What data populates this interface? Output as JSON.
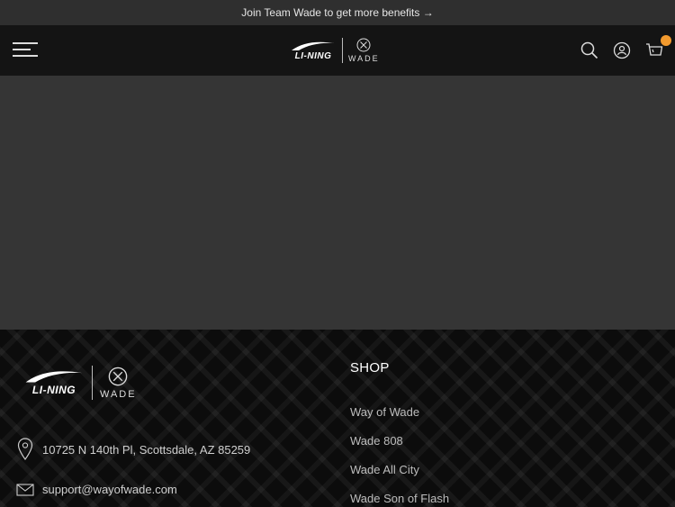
{
  "announcement": {
    "text": "Join Team Wade to get more benefits →"
  },
  "header": {
    "brand_name": "LI-NING",
    "sub_brand": "WADE",
    "cart_count": ""
  },
  "footer": {
    "brand_name": "LI-NING",
    "sub_brand": "WADE",
    "address": "10725 N 140th Pl, Scottsdale, AZ 85259",
    "email": "support@wayofwade.com",
    "shop": {
      "title": "SHOP",
      "links": [
        "Way of Wade",
        "Wade 808",
        "Wade All City",
        "Wade Son of Flash"
      ]
    }
  },
  "colors": {
    "announcement_bg": "#2f2f2f",
    "header_bg": "#141414",
    "hero_bg": "#353535",
    "footer_bg": "#0c0c0c",
    "cart_badge": "#f29a2e"
  },
  "icons": [
    "hamburger-icon",
    "search-icon",
    "account-icon",
    "cart-icon",
    "location-pin-icon",
    "mail-icon",
    "wade-logo-icon"
  ]
}
